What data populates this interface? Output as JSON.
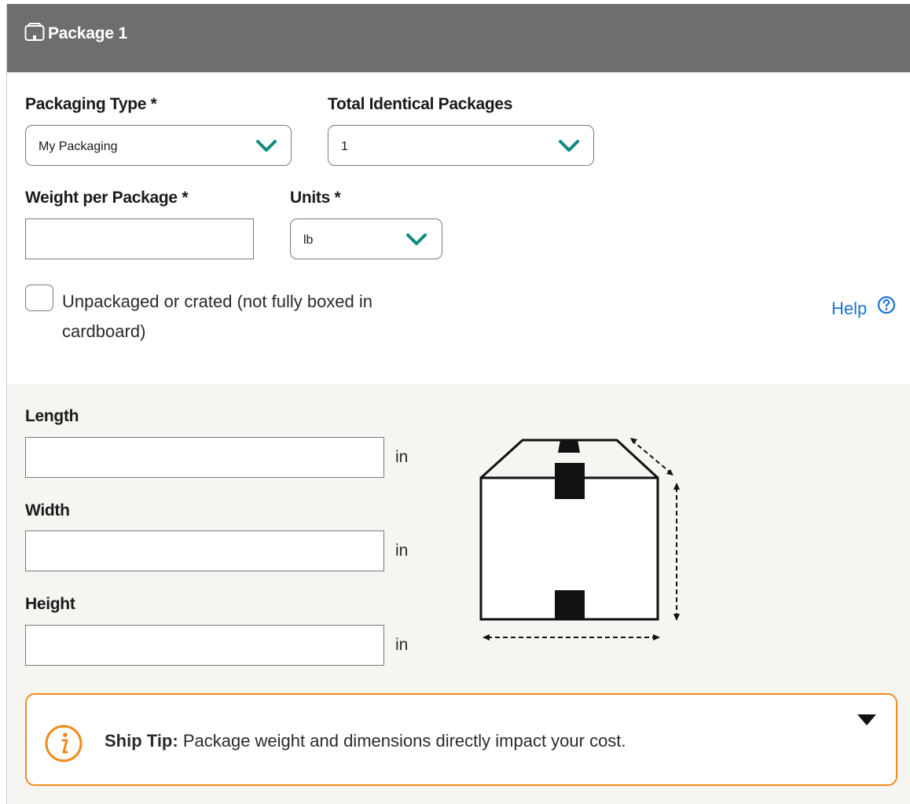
{
  "header": {
    "title": "Package 1",
    "icon": "package-icon"
  },
  "packaging_type": {
    "label": "Packaging Type *",
    "value": "My Packaging"
  },
  "total_identical": {
    "label": "Total Identical Packages",
    "value": "1"
  },
  "weight": {
    "label": "Weight per Package *",
    "value": ""
  },
  "units": {
    "label": "Units *",
    "value": "lb"
  },
  "unpackaged": {
    "label": "Unpackaged or crated (not fully boxed in cardboard)",
    "checked": false
  },
  "help": {
    "label": "Help",
    "icon": "question-circle-icon"
  },
  "dimensions": {
    "length": {
      "label": "Length",
      "value": "",
      "unit": "in"
    },
    "width": {
      "label": "Width",
      "value": "",
      "unit": "in"
    },
    "height": {
      "label": "Height",
      "value": "",
      "unit": "in"
    }
  },
  "ship_tip": {
    "prefix": "Ship Tip:",
    "text": " Package weight and dimensions directly impact your cost.",
    "icon": "info-icon"
  },
  "colors": {
    "header_bg": "#6e6e6e",
    "accent_teal": "#0f8a7e",
    "link_blue": "#1a73c9",
    "tip_orange": "#f08a1c"
  }
}
